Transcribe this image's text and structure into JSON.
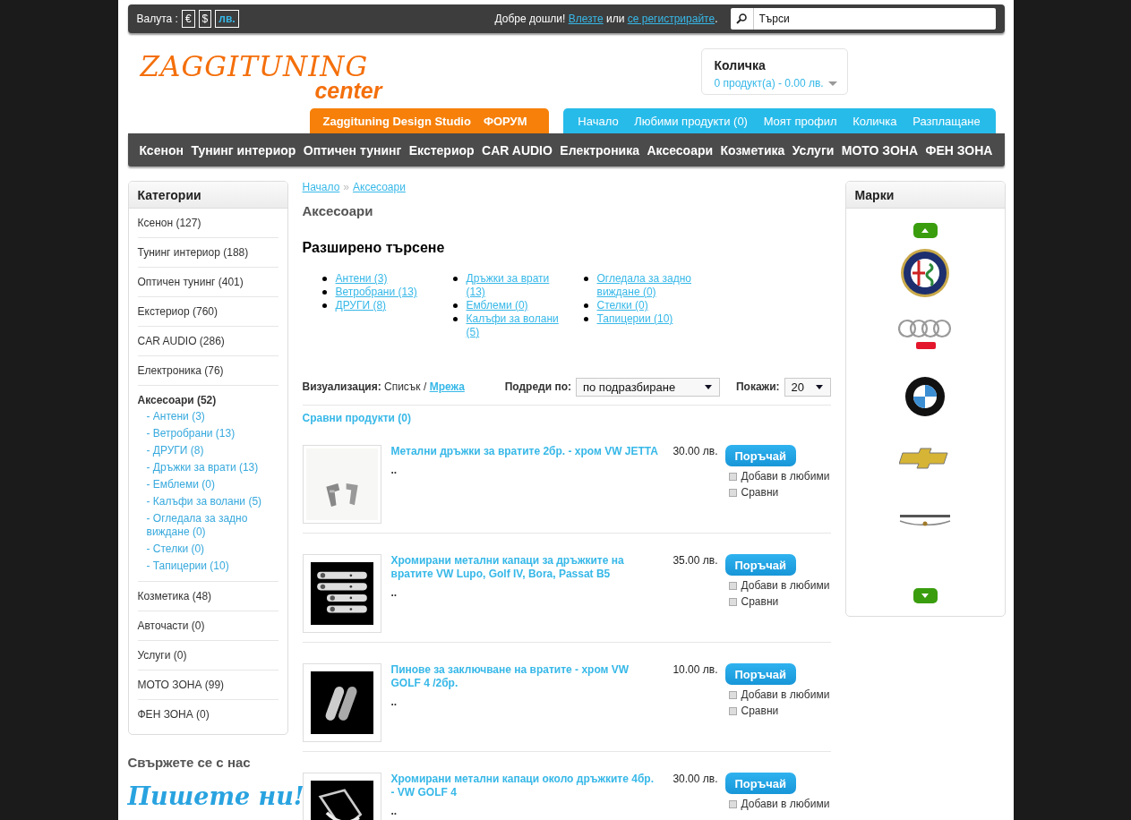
{
  "top_bar": {
    "currency_label": "Валута :",
    "currencies": [
      {
        "label": "€",
        "selected": false
      },
      {
        "label": "$",
        "selected": false
      },
      {
        "label": "лв.",
        "selected": true
      }
    ],
    "welcome": "Добре дошли!",
    "login": "Влезте",
    "or": "или",
    "register": "се регистрирайте",
    "period": ".",
    "search": {
      "placeholder": "Търси"
    }
  },
  "logo": {
    "line_1": "ZAGGITUNING",
    "line_2": "center"
  },
  "cart": {
    "title": "Количка",
    "summary": "0 продукт(а) - 0.00 лв."
  },
  "orange_tabs": [
    "Zaggituning Design Studio",
    "ФОРУМ"
  ],
  "blue_tabs": [
    "Начало",
    "Любими продукти (0)",
    "Моят профил",
    "Количка",
    "Разплащане"
  ],
  "main_nav": [
    "Ксенон",
    "Тунинг интериор",
    "Оптичен тунинг",
    "Екстериор",
    "CAR AUDIO",
    "Електроника",
    "Аксесоари",
    "Козметика",
    "Услуги",
    "МОТО ЗОНА",
    "ФЕН ЗОНА"
  ],
  "categories": {
    "title": "Категории",
    "items": [
      {
        "label": "Ксенон (127)",
        "selected": false
      },
      {
        "label": "Тунинг интериор (188)",
        "selected": false
      },
      {
        "label": "Оптичен тунинг (401)",
        "selected": false
      },
      {
        "label": "Екстериор (760)",
        "selected": false
      },
      {
        "label": "CAR AUDIO (286)",
        "selected": false
      },
      {
        "label": "Електроника (76)",
        "selected": false
      },
      {
        "label": "Аксесоари (52)",
        "selected": true,
        "children": [
          {
            "label": "- Антени (3)"
          },
          {
            "label": "- Ветробрани (13)"
          },
          {
            "label": "- ДРУГИ (8)"
          },
          {
            "label": "- Дръжки за врати (13)"
          },
          {
            "label": "- Емблеми (0)"
          },
          {
            "label": "- Калъфи за волани (5)"
          },
          {
            "label": "- Огледала за задно виждане (0)"
          },
          {
            "label": "- Стелки (0)"
          },
          {
            "label": "- Тапицерии (10)"
          }
        ]
      },
      {
        "label": "Козметика (48)",
        "selected": false
      },
      {
        "label": "Авточасти (0)",
        "selected": false
      },
      {
        "label": "Услуги (0)",
        "selected": false
      },
      {
        "label": "МОТО ЗОНА (99)",
        "selected": false
      },
      {
        "label": "ФЕН ЗОНА (0)",
        "selected": false
      }
    ]
  },
  "contact": {
    "title": "Свържете се с нас",
    "write_us": "Пишете ни!"
  },
  "breadcrumb": [
    "Начало",
    "Аксесоари"
  ],
  "breadcrumb_separator": "»",
  "page_title": "Аксесоари",
  "refine": {
    "title": "Разширено търсене",
    "columns": [
      [
        "Антени (3)",
        "Ветробрани (13)",
        "ДРУГИ (8)"
      ],
      [
        "Дръжки за врати (13)",
        "Емблеми (0)",
        "Калъфи за волани (5)"
      ],
      [
        "Огледала за задно виждане (0)",
        "Стелки (0)",
        "Тапицерии (10)"
      ]
    ]
  },
  "view": {
    "label": "Визуализация:",
    "list": "Списък",
    "separator": "/",
    "grid": "Мрежа"
  },
  "sort": {
    "label": "Подреди по:",
    "value": "по подразбиране"
  },
  "limit": {
    "label": "Покажи:",
    "value": "20"
  },
  "compare_link": "Сравни продукти (0)",
  "brands": {
    "title": "Марки"
  },
  "products": [
    {
      "name": "Метални дръжки за вратите 2бр. - хром VW JETTA",
      "description": "..",
      "price": "30.00 лв.",
      "button": "Поръчай",
      "wishlist": "Добави в любими",
      "compare": "Сравни"
    },
    {
      "name": "Хромирани метални капаци за дръжките на вратите VW Lupo, Golf IV, Bora, Passat B5",
      "description": "..",
      "price": "35.00 лв.",
      "button": "Поръчай",
      "wishlist": "Добави в любими",
      "compare": "Сравни"
    },
    {
      "name": "Пинове за заключване на вратите - хром VW GOLF 4 /2бр.",
      "description": "..",
      "price": "10.00 лв.",
      "button": "Поръчай",
      "wishlist": "Добави в любими",
      "compare": "Сравни"
    },
    {
      "name": "Хромирани метални капаци около дръжките 4бр. - VW GOLF 4",
      "description": "..",
      "price": "30.00 лв.",
      "button": "Поръчай",
      "wishlist": "Добави в любими"
    }
  ]
}
